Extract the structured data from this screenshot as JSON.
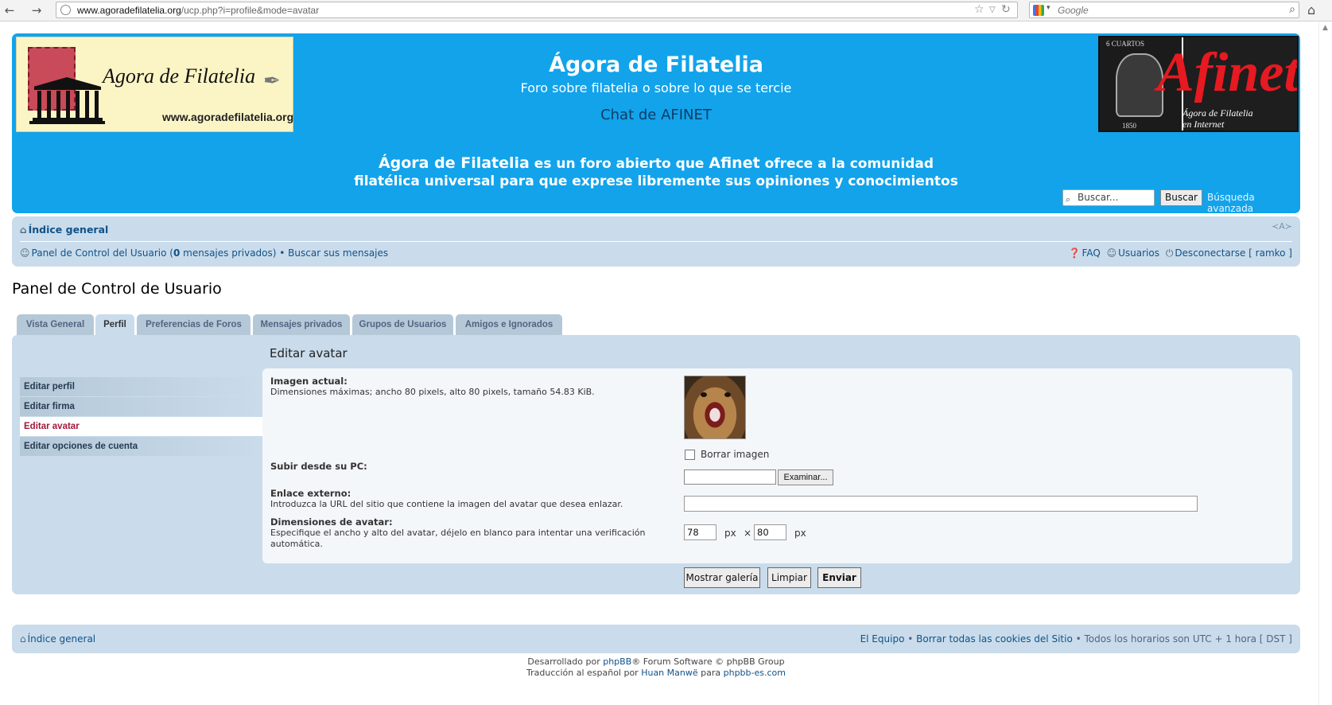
{
  "browser": {
    "url_domain": "www.agoradefilatelia.org",
    "url_path": "/ucp.php?i=profile&mode=avatar",
    "search_engine_placeholder": "Google"
  },
  "header": {
    "logo_left_title": "Agora de Filatelia",
    "logo_left_url": "www.agoradefilatelia.org",
    "site_title": "Ágora de Filatelia",
    "site_description": "Foro sobre filatelia o sobre lo que se tercie",
    "chat_link": "Chat de AFINET",
    "tagline_bold1": "Ágora de Filatelia",
    "tagline_mid1": " es un foro abierto que ",
    "tagline_bold2": "Afinet",
    "tagline_mid2": " ofrece a la comunidad",
    "tagline_line2": "filatélica universal para que exprese libremente sus opiniones y conocimientos",
    "logo_right_brand": "finet",
    "logo_right_sub1": "Ágora de Filatelia",
    "logo_right_sub2": "en Internet",
    "logo_right_stamp_top": "6 CUARTOS",
    "logo_right_stamp_bottom": "1850",
    "search_placeholder": "Buscar...",
    "search_button": "Buscar",
    "advanced_search": "Búsqueda avanzada"
  },
  "navbar": {
    "index_link": "Índice general",
    "ucp_link": "Panel de Control del Usuario",
    "pm_open": " (",
    "pm_count": "0",
    "pm_text": " mensajes privados)",
    "bullet": " • ",
    "search_messages": "Buscar sus mensajes",
    "faq": "FAQ",
    "users": "Usuarios",
    "logout": "Desconectarse [ ramko ]",
    "font_resize": "≺A≻"
  },
  "page_title": "Panel de Control de Usuario",
  "tabs": [
    {
      "label": "Vista General",
      "active": false
    },
    {
      "label": "Perfil",
      "active": true
    },
    {
      "label": "Preferencias de Foros",
      "active": false
    },
    {
      "label": "Mensajes privados",
      "active": false
    },
    {
      "label": "Grupos de Usuarios",
      "active": false
    },
    {
      "label": "Amigos e Ignorados",
      "active": false
    }
  ],
  "menu": [
    {
      "label": "Editar perfil",
      "active": false
    },
    {
      "label": "Editar firma",
      "active": false
    },
    {
      "label": "Editar avatar",
      "active": true
    },
    {
      "label": "Editar opciones de cuenta",
      "active": false
    }
  ],
  "form": {
    "title": "Editar avatar",
    "current_image_label": "Imagen actual:",
    "current_image_desc": "Dimensiones máximas; ancho 80 pixels, alto 80 pixels, tamaño 54.83 KiB.",
    "delete_image": "Borrar imagen",
    "upload_label": "Subir desde su PC:",
    "browse_button": "Examinar...",
    "external_link_label": "Enlace externo:",
    "external_link_desc": "Introduzca la URL del sitio que contiene la imagen del avatar que desea enlazar.",
    "dimensions_label": "Dimensiones de avatar:",
    "dimensions_desc_1": "Especifique el ancho y alto del avatar, déjelo en blanco para intentar una verificación",
    "dimensions_desc_2": "automática.",
    "width_value": "78",
    "height_value": "80",
    "px": "px",
    "times": "×",
    "show_gallery": "Mostrar galería",
    "reset": "Limpiar",
    "submit": "Enviar"
  },
  "footer": {
    "index_link": "Índice general",
    "team": "El Equipo",
    "bullet": " • ",
    "delete_cookies": "Borrar todas las cookies del Sitio",
    "timezone": "Todos los horarios son UTC + 1 hora [ DST ]",
    "powered_1": "Desarrollado por ",
    "powered_link": "phpBB",
    "powered_2": "® Forum Software © phpBB Group",
    "translation_1": "Traducción al español por ",
    "translation_link1": "Huan Manwë",
    "translation_2": " para ",
    "translation_link2": "phpbb-es.com"
  },
  "colors": {
    "header_bg": "#12a3eb",
    "panel_bg": "#cadceb",
    "link": "#105289",
    "active_menu": "#a0183a"
  }
}
